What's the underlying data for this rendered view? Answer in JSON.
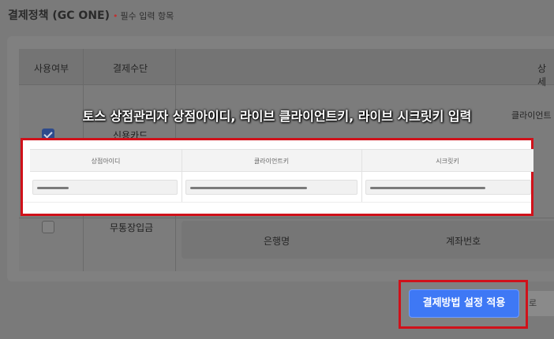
{
  "page": {
    "title": "결제정책 (GC ONE)",
    "required_note": "필수 입력 항목"
  },
  "table": {
    "headers": {
      "use": "사용여부",
      "method": "결제수단",
      "detail": "상세"
    },
    "rows": [
      {
        "label": "신용카드",
        "checked": true
      },
      {
        "label": "무통장입금",
        "checked": false
      }
    ],
    "bg_labels": {
      "client_key_partial": "클라이언트",
      "bank_name": "은행명",
      "account_number": "계좌번호"
    }
  },
  "instruction": "토스 상점관리자 상점아이디, 라이브 클라이언트키, 라이브 시크릿키 입력",
  "fields": {
    "store_id": {
      "label": "상점아이디"
    },
    "client_key": {
      "label": "클라이언트키"
    },
    "secret_key": {
      "label": "시크릿키"
    }
  },
  "buttons": {
    "apply": "결제방법 설정 적용",
    "secondary_partial": "로"
  },
  "colors": {
    "highlight": "#d0111a",
    "primary": "#3e78f5"
  }
}
